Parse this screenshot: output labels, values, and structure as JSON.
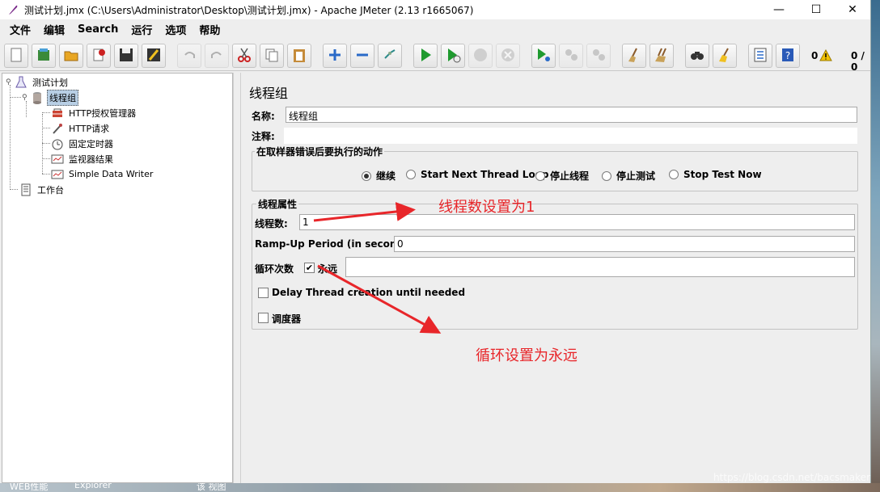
{
  "window": {
    "title": "测试计划.jmx (C:\\Users\\Administrator\\Desktop\\测试计划.jmx) - Apache JMeter (2.13 r1665067)",
    "minimize": "—",
    "maximize": "☐",
    "close": "✕"
  },
  "menu": [
    "文件",
    "编辑",
    "Search",
    "运行",
    "选项",
    "帮助"
  ],
  "toolbar": {
    "error_count": "0",
    "thread_ratio": "0 / 0"
  },
  "tree": {
    "items": [
      {
        "label": "测试计划",
        "icon": "test-plan-icon"
      },
      {
        "label": "线程组",
        "icon": "thread-group-icon"
      },
      {
        "label": "HTTP授权管理器",
        "icon": "auth-manager-icon"
      },
      {
        "label": "HTTP请求",
        "icon": "sampler-icon"
      },
      {
        "label": "固定定时器",
        "icon": "timer-icon"
      },
      {
        "label": "监视器结果",
        "icon": "listener-icon"
      },
      {
        "label": "Simple Data Writer",
        "icon": "listener-icon"
      },
      {
        "label": "工作台",
        "icon": "workbench-icon"
      }
    ]
  },
  "panel": {
    "title": "线程组",
    "name_label": "名称:",
    "name_value": "线程组",
    "comment_label": "注释:",
    "comment_value": "",
    "on_error": {
      "title": "在取样器错误后要执行的动作",
      "options": [
        "继续",
        "Start Next Thread Loop",
        "停止线程",
        "停止测试",
        "Stop Test Now"
      ],
      "selected": "继续"
    },
    "thread_props": {
      "title": "线程属性",
      "threads_label": "线程数:",
      "threads_value": "1",
      "rampup_label": "Ramp-Up Period (in seconds):",
      "rampup_value": "0",
      "loop_label": "循环次数",
      "forever_label": "永远",
      "forever_checked": true,
      "loop_value": "",
      "delay_label": "Delay Thread creation until needed",
      "scheduler_label": "调度器"
    }
  },
  "annotations": {
    "threads_note": "线程数设置为1",
    "loop_note": "循环设置为永远"
  },
  "taskbar": [
    "WEB性能",
    "Explorer",
    "该 视图"
  ],
  "watermark": "https://blog.csdn.net/bacsmaker"
}
